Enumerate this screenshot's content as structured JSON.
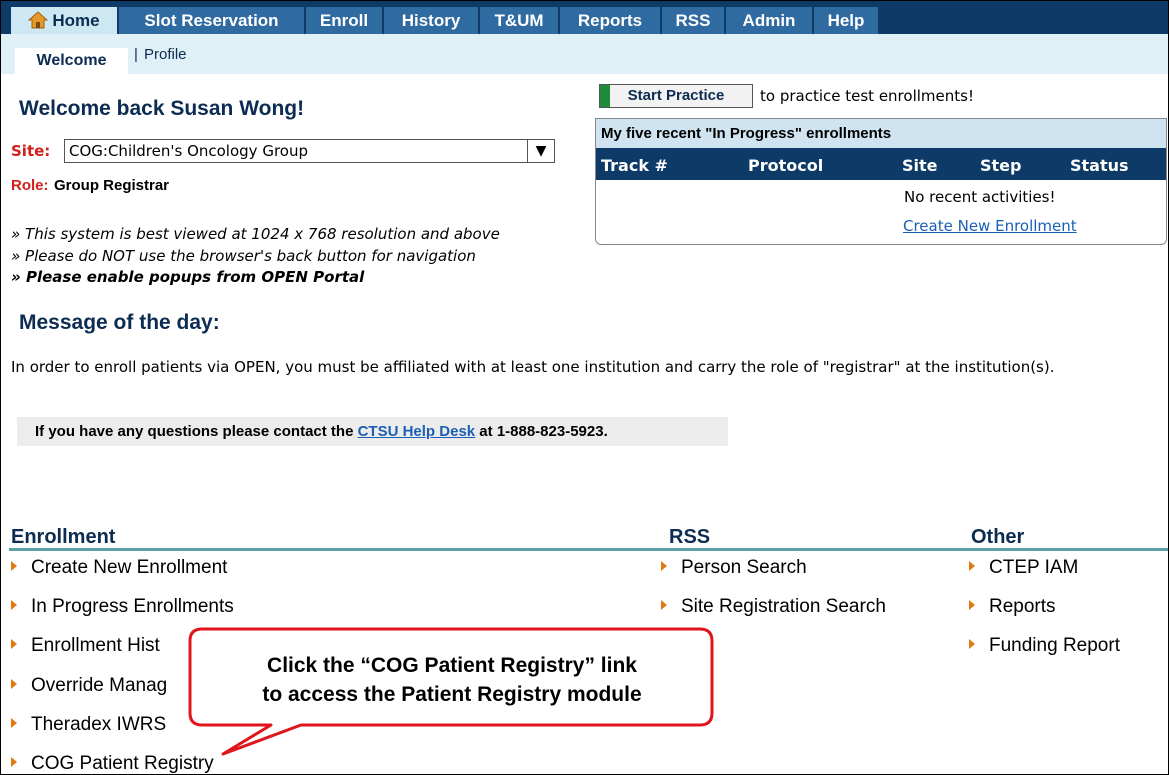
{
  "nav": {
    "tabs": [
      {
        "label": "Home",
        "active": true
      },
      {
        "label": "Slot Reservation"
      },
      {
        "label": "Enroll"
      },
      {
        "label": "History"
      },
      {
        "label": "T&UM"
      },
      {
        "label": "Reports"
      },
      {
        "label": "RSS"
      },
      {
        "label": "Admin"
      },
      {
        "label": "Help"
      }
    ],
    "subtabs": {
      "welcome": "Welcome",
      "separator": "|",
      "profile": "Profile"
    }
  },
  "welcome": {
    "title": "Welcome back Susan Wong!",
    "site_label": "Site:",
    "site_value": "COG:Children's Oncology Group",
    "role_label": "Role:",
    "role_value": "Group Registrar"
  },
  "notes": [
    "» This system is best viewed at 1024 x 768 resolution and above",
    "» Please do NOT use the browser's back button for navigation",
    "» Please enable popups from OPEN Portal"
  ],
  "practice": {
    "button": "Start Practice",
    "text": "to practice test enrollments!"
  },
  "recent": {
    "title": "My five recent \"In Progress\" enrollments",
    "columns": [
      "Track #",
      "Protocol",
      "Site",
      "Step",
      "Status"
    ],
    "empty": "No recent activities!",
    "create_link": "Create New Enrollment"
  },
  "motd": {
    "title": "Message of the day:",
    "body": "In order to enroll patients via OPEN, you must be affiliated with at least one institution and carry the role of \"registrar\" at the institution(s).",
    "help_prefix": "If you have any questions please contact the ",
    "help_link": "CTSU Help Desk",
    "help_suffix": " at 1-888-823-5923."
  },
  "sections": {
    "enrollment": {
      "title": "Enrollment",
      "links": [
        "Create New Enrollment",
        "In Progress Enrollments",
        "Enrollment Hist",
        "Override Manag",
        "Theradex IWRS",
        "COG Patient Registry"
      ]
    },
    "rss": {
      "title": "RSS",
      "links": [
        "Person Search",
        "Site Registration Search"
      ]
    },
    "other": {
      "title": "Other",
      "links": [
        "CTEP IAM",
        "Reports",
        "Funding Report"
      ]
    }
  },
  "callout": {
    "line1": "Click the “COG Patient Registry” link",
    "line2": "to access the Patient Registry module"
  },
  "colors": {
    "nav_dark": "#0d3a66",
    "tab_blue": "#2f6aa1",
    "bullet": "#e07a10",
    "callout_border": "#e0151b"
  }
}
